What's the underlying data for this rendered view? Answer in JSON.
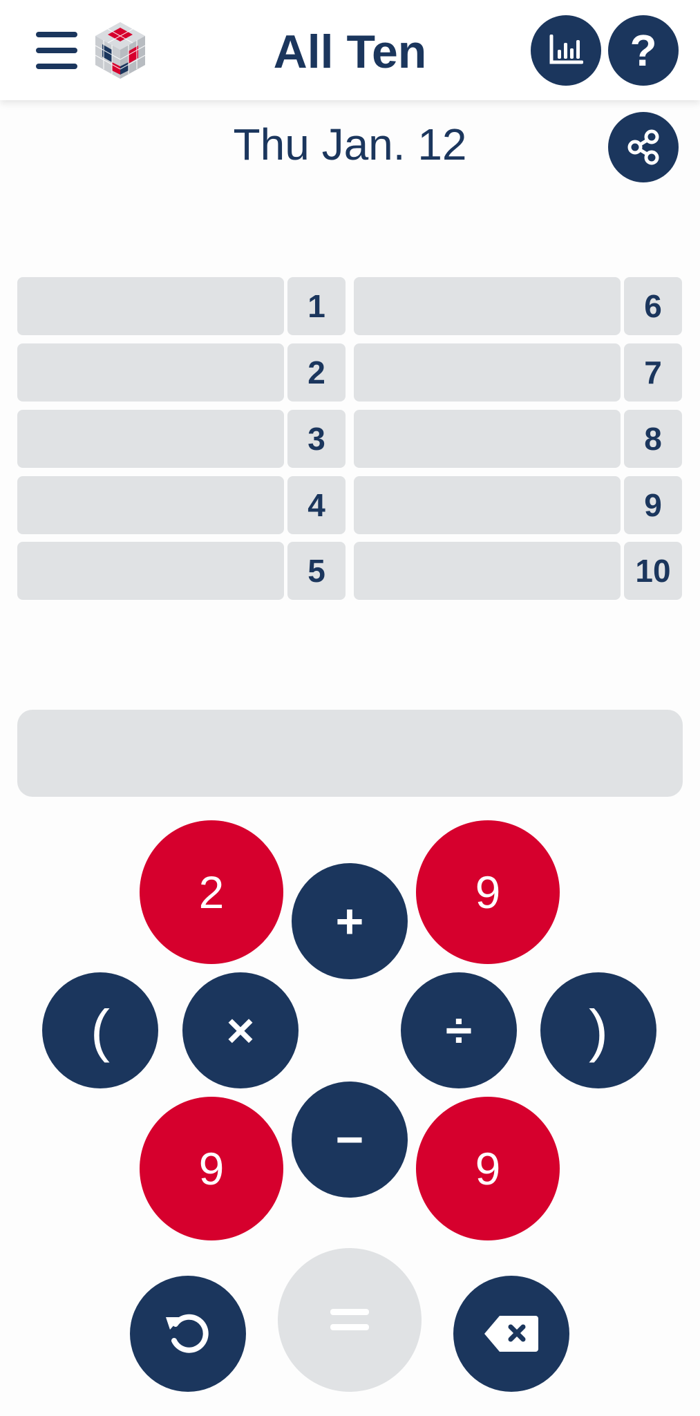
{
  "header": {
    "title": "All Ten",
    "menu_icon": "hamburger-menu-icon",
    "logo_icon": "cube-logo-icon",
    "stats_icon": "bar-chart-icon",
    "help_label": "?"
  },
  "date": "Thu Jan. 12",
  "share_icon": "share-icon",
  "targets": {
    "left": [
      "1",
      "2",
      "3",
      "4",
      "5"
    ],
    "right": [
      "6",
      "7",
      "8",
      "9",
      "10"
    ]
  },
  "expression": "",
  "keypad": {
    "numbers": [
      "2",
      "9",
      "9",
      "9"
    ],
    "plus": "+",
    "times": "×",
    "divide": "÷",
    "minus": "−",
    "open_paren": "(",
    "close_paren": ")",
    "equals_icon": "equals-icon",
    "undo_icon": "undo-icon",
    "backspace_icon": "backspace-icon"
  },
  "colors": {
    "navy": "#1b365d",
    "red": "#d6002d",
    "cell_gray": "#e0e2e4"
  }
}
